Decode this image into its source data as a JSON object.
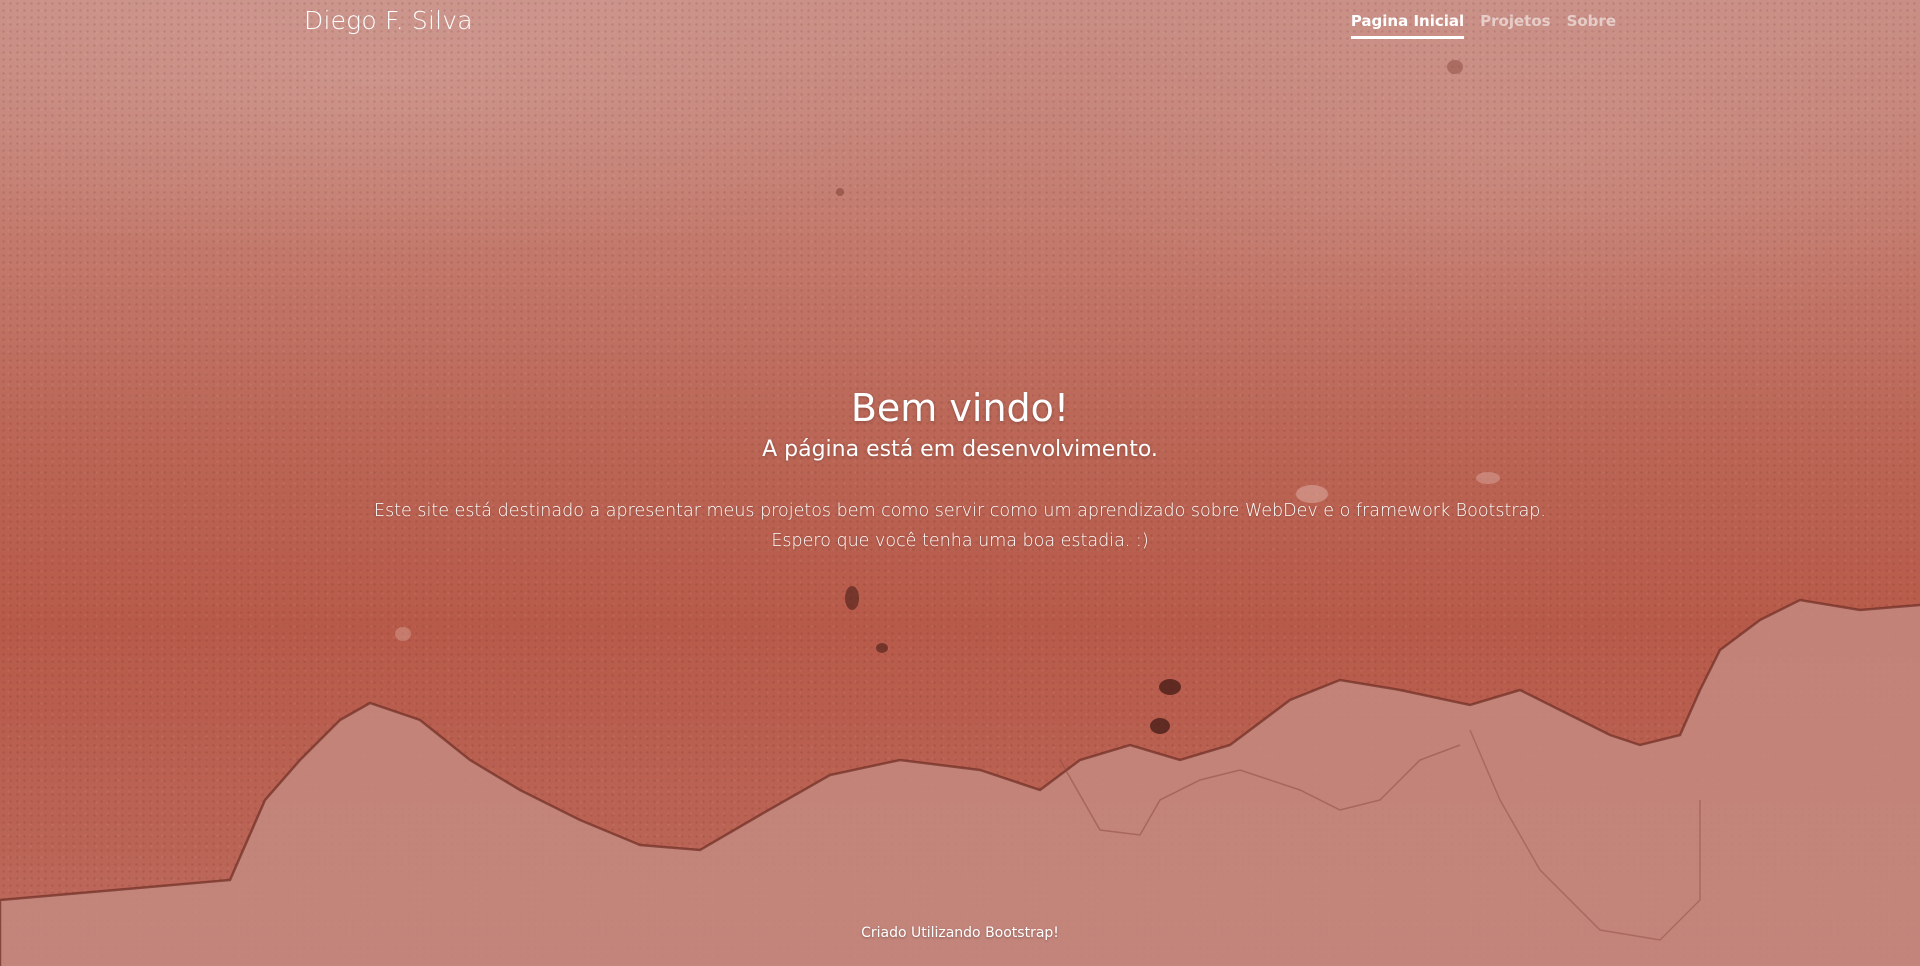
{
  "navbar": {
    "brand": "Diego F. Silva",
    "links": [
      {
        "label": "Pagina Inicial",
        "active": true
      },
      {
        "label": "Projetos",
        "active": false
      },
      {
        "label": "Sobre",
        "active": false
      }
    ]
  },
  "cover": {
    "title": "Bem vindo!",
    "subtitle": "A página está em desenvolvimento.",
    "lead_line1": "Este site está destinado a apresentar meus projetos bem como servir como um aprendizado sobre WebDev e o framework Bootstrap.",
    "lead_line2": "Espero que você tenha uma boa estadia. :)"
  },
  "footer": {
    "text": "Criado Utilizando Bootstrap!"
  },
  "colors": {
    "wall_dark": "#b85a4a",
    "wall_light": "#c98f86",
    "plaster": "#c98d83",
    "text": "#ffffff"
  }
}
